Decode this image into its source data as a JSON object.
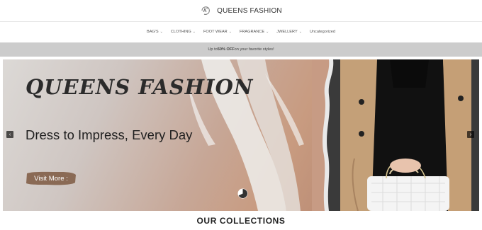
{
  "header": {
    "brand": "QUEENS FASHION",
    "logo_icon": "queens-logo-icon"
  },
  "nav": {
    "items": [
      {
        "label": "BAG'S",
        "dropdown": true
      },
      {
        "label": "CLOTHING",
        "dropdown": true
      },
      {
        "label": "FOOT WEAR",
        "dropdown": true
      },
      {
        "label": "FRAGRANCE",
        "dropdown": true
      },
      {
        "label": "JWELLERY",
        "dropdown": true
      },
      {
        "label": "Uncategorized",
        "dropdown": false
      }
    ],
    "chevron": "⌄"
  },
  "promo": {
    "prefix": "Up to ",
    "highlight": "50% OFF",
    "suffix": " on your favorite styles!"
  },
  "hero": {
    "title": "QUEENS FASHION",
    "subtitle": "Dress to Impress, Every Day",
    "cta": "Visit More :",
    "prev_icon": "‹",
    "next_icon": "›"
  },
  "section": {
    "title": "OUR COLLECTIONS"
  },
  "colors": {
    "promo_bg": "#cccccc",
    "cta": "#8a6a55",
    "coat": "#c9a57c"
  }
}
